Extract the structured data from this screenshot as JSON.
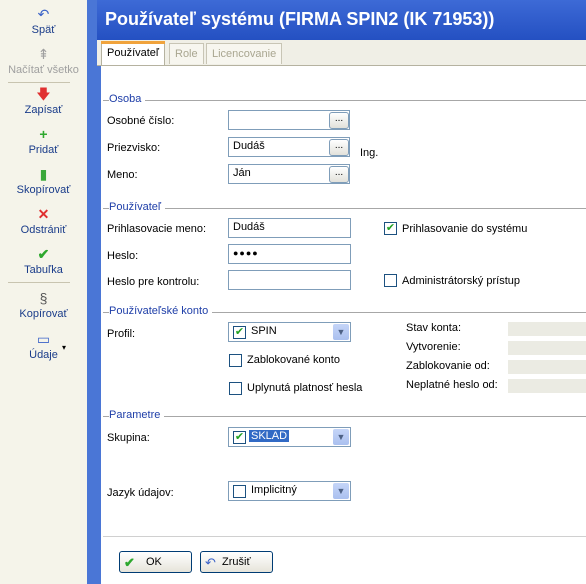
{
  "toolbar": {
    "items": [
      {
        "label": "Späť",
        "icon": "undo-icon"
      },
      {
        "label": "Načítať všetko",
        "icon": "load-all-icon"
      },
      {
        "label": "Zapísať",
        "icon": "save-icon"
      },
      {
        "label": "Pridať",
        "icon": "add-icon"
      },
      {
        "label": "Skopírovať",
        "icon": "copy-icon"
      },
      {
        "label": "Odstrániť",
        "icon": "delete-icon"
      },
      {
        "label": "Tabuľka",
        "icon": "table-icon"
      },
      {
        "label": "Kopírovať",
        "icon": "paragraph-icon"
      },
      {
        "label": "Údaje",
        "icon": "data-icon"
      }
    ]
  },
  "window": {
    "title": "Používateľ systému (FIRMA SPIN2 (IK 71953))"
  },
  "tabs": [
    {
      "label": "Používateľ",
      "active": true
    },
    {
      "label": "Role",
      "active": false
    },
    {
      "label": "Licencovanie",
      "active": false
    }
  ],
  "osoba": {
    "section_title": "Osoba",
    "osobne_cislo_label": "Osobné číslo:",
    "osobne_cislo_value": "",
    "priezvisko_label": "Priezvisko:",
    "priezvisko_value": "Dudáš",
    "titul": "Ing.",
    "meno_label": "Meno:",
    "meno_value": "Ján",
    "dots": "..."
  },
  "pouzivatel": {
    "section_title": "Používateľ",
    "login_label": "Prihlasovacie meno:",
    "login_value": "Dudáš",
    "heslo_label": "Heslo:",
    "heslo_value": "●●●●",
    "heslo_kontrola_label": "Heslo pre kontrolu:",
    "heslo_kontrola_value": "",
    "prihlasovanie_label": "Prihlasovanie do systému",
    "prihlasovanie_checked": true,
    "admin_label": "Administrátorský prístup",
    "admin_checked": false
  },
  "konto": {
    "section_title": "Používateľské konto",
    "profil_label": "Profil:",
    "profil_value": "SPIN",
    "zablokovane_label": "Zablokované konto",
    "uplynuta_label": "Uplynutá platnosť hesla",
    "stav_label": "Stav konta:",
    "vytvorenie_label": "Vytvorenie:",
    "zablokovanie_label": "Zablokovanie od:",
    "neplatne_label": "Neplatné heslo od:"
  },
  "parametre": {
    "section_title": "Parametre",
    "skupina_label": "Skupina:",
    "skupina_value": "SKLAD",
    "jazyk_label": "Jazyk údajov:",
    "jazyk_value": "Implicitný"
  },
  "buttons": {
    "ok": "OK",
    "cancel": "Zrušiť"
  },
  "colors": {
    "accent": "#2450c2",
    "section": "#1e3ea8",
    "tab_highlight": "#f0a33c"
  }
}
